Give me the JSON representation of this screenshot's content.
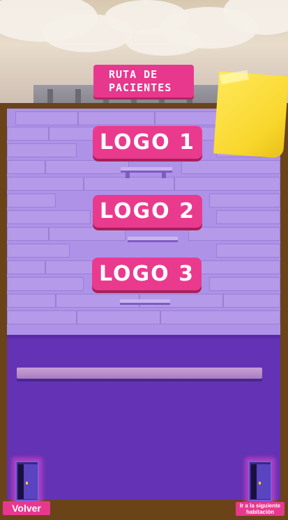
{
  "title": "RUTA DE PACIENTES",
  "logos": [
    {
      "label": "LOGO 1"
    },
    {
      "label": "LOGO 2"
    },
    {
      "label": "LOGO 3"
    }
  ],
  "nav": {
    "back_label": "Volver",
    "next_label": "Ir a la siguiente habitación"
  },
  "colors": {
    "button": "#ea3a8e",
    "wall": "#ad92e8",
    "floor": "#6432b4",
    "frame": "#6a4418",
    "note": "#f8d62c"
  }
}
